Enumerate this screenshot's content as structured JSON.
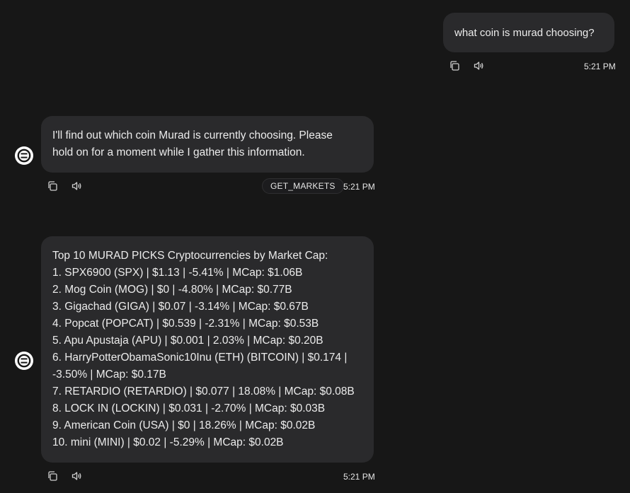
{
  "messages": {
    "user": {
      "text": "what coin is murad choosing?",
      "time": "5:21 PM"
    },
    "agent_1": {
      "lines": [
        "I'll find out which coin Murad is currently choosing. Please",
        "hold on for a moment while I gather this information."
      ],
      "action_tag": "GET_MARKETS",
      "time": "5:21 PM"
    },
    "agent_2": {
      "lines": [
        "Top 10 MURAD PICKS Cryptocurrencies by Market Cap:",
        "1. SPX6900 (SPX) | $1.13 | -5.41% | MCap: $1.06B",
        "2. Mog Coin (MOG) | $0 | -4.80% | MCap: $0.77B",
        "3. Gigachad (GIGA) | $0.07 | -3.14% | MCap: $0.67B",
        "4. Popcat (POPCAT) | $0.539 | -2.31% | MCap: $0.53B",
        "5. Apu Apustaja (APU) | $0.001 | 2.03% | MCap: $0.20B",
        "6. HarryPotterObamaSonic10Inu (ETH) (BITCOIN) | $0.174 |",
        "-3.50% | MCap: $0.17B",
        "7. RETARDIO (RETARDIO) | $0.077 | 18.08% | MCap: $0.08B",
        "8. LOCK IN (LOCKIN) | $0.031 | -2.70% | MCap: $0.03B",
        "9. American Coin (USA) | $0 | 18.26% | MCap: $0.02B",
        "10. mini (MINI) | $0.02 | -5.29% | MCap: $0.02B"
      ],
      "time": "5:21 PM"
    }
  },
  "icons": {
    "copy": "copy-icon",
    "speaker": "speaker-icon",
    "avatar": "eliza-logo-icon"
  },
  "colors": {
    "background": "#171717",
    "bubble": "#2a2a2c",
    "text": "#ececec",
    "avatar": "#ffffff"
  }
}
